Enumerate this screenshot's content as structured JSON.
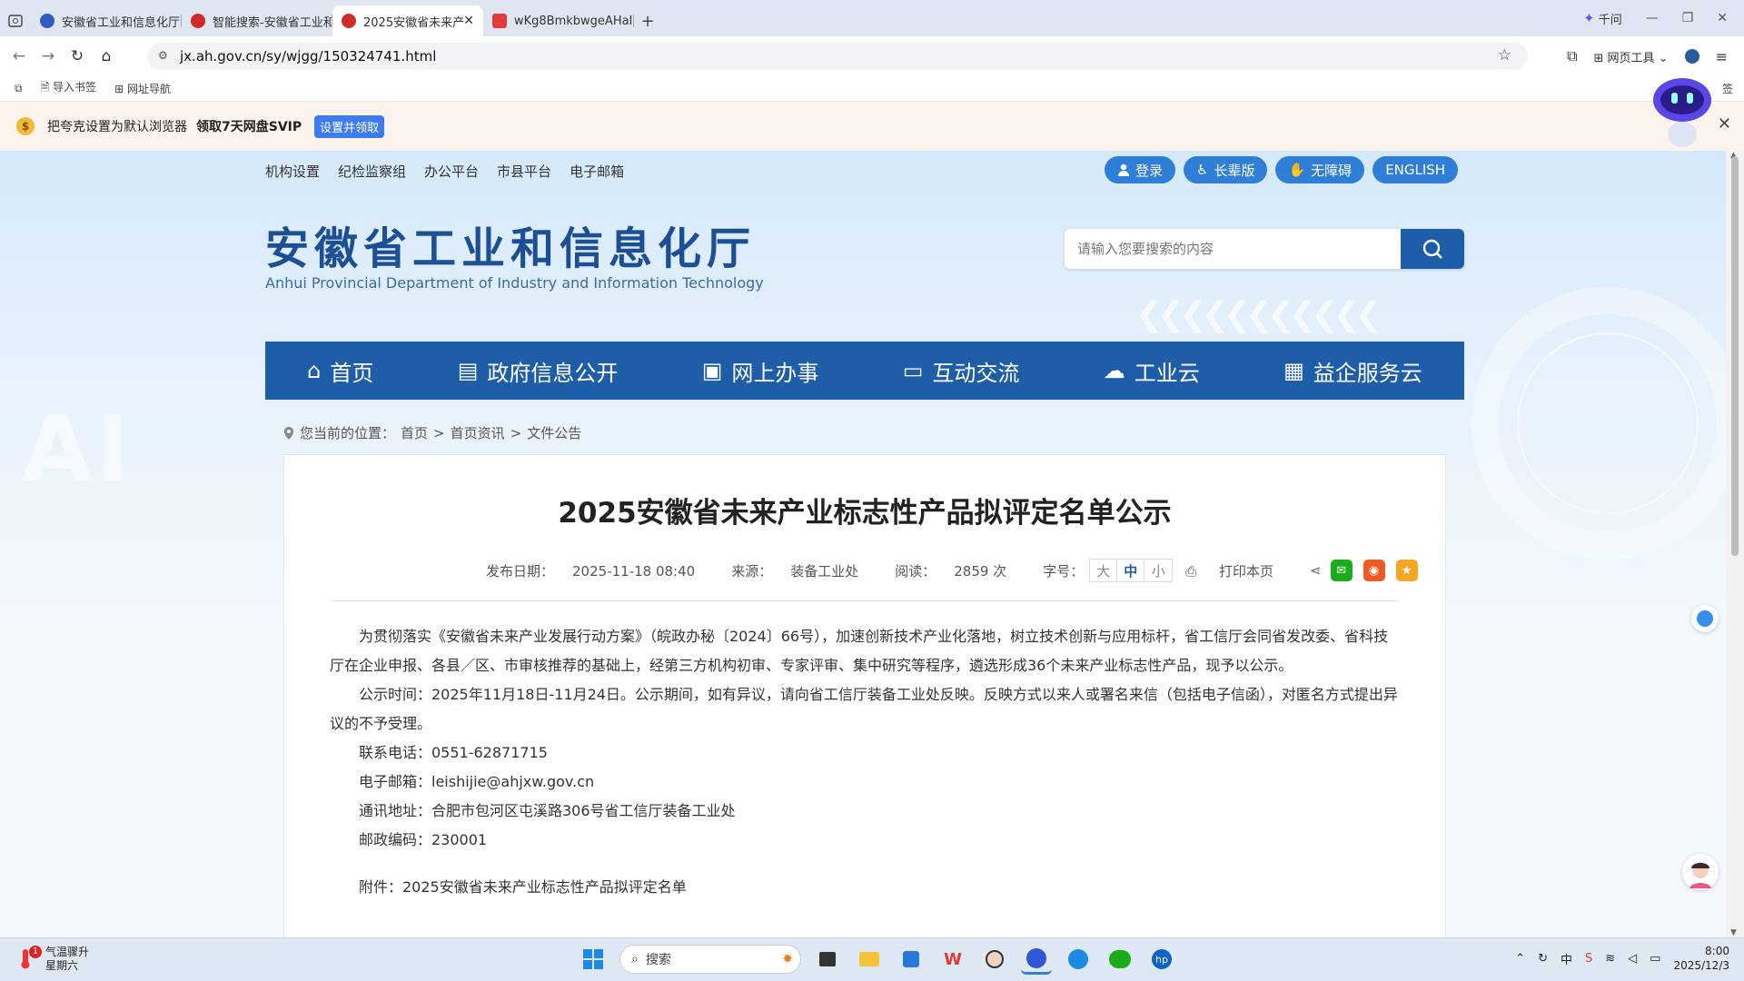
{
  "browser": {
    "tabs": [
      {
        "label": "安徽省工业和信息化厅",
        "active": false
      },
      {
        "label": "智能搜索-安徽省工业和",
        "active": false
      },
      {
        "label": "2025安徽省未来产",
        "active": true
      },
      {
        "label": "wKg8BmkbwgeAHaIl",
        "active": false
      }
    ],
    "qianwen": "千问",
    "url": "jx.ah.gov.cn/sy/wjgg/150324741.html",
    "web_tools": "网页工具",
    "bookmarks": [
      "导入书签",
      "网址导航"
    ],
    "bm_overflow": "签"
  },
  "promo": {
    "text": "把夸克设置为默认浏览器",
    "bold": "领取7天网盘SVIP",
    "button": "设置并领取",
    "coin": "$"
  },
  "site": {
    "top_links": [
      "机构设置",
      "纪检监察组",
      "办公平台",
      "市县平台",
      "电子邮箱"
    ],
    "top_buttons": [
      "登录",
      "长辈版",
      "无障碍",
      "ENGLISH"
    ],
    "title_cn": "安徽省工业和信息化厅",
    "title_en": "Anhui Provincial Department of Industry and Information Technology",
    "search_placeholder": "请输入您要搜索的内容",
    "nav": [
      "首页",
      "政府信息公开",
      "网上办事",
      "互动交流",
      "工业云",
      "益企服务云"
    ],
    "bg_text": "AI",
    "breadcrumb": {
      "label": "您当前的位置：",
      "items": [
        "首页",
        "首页资讯",
        "文件公告"
      ],
      "sep": ">"
    }
  },
  "article": {
    "title": "2025安徽省未来产业标志性产品拟评定名单公示",
    "date_label": "发布日期：",
    "date": "2025-11-18 08:40",
    "source_label": "来源：",
    "source": "装备工业处",
    "read_label": "阅读：",
    "reads": "2859 次",
    "font_label": "字号：",
    "font_sizes": [
      "大",
      "中",
      "小"
    ],
    "print": "打印本页",
    "paragraphs": [
      "为贯彻落实《安徽省未来产业发展行动方案》（皖政办秘〔2024〕66号），加速创新技术产业化落地，树立技术创新与应用标杆，省工信厅会同省发改委、省科技厅在企业申报、各县／区、市审核推荐的基础上，经第三方机构初审、专家评审、集中研究等程序，遴选形成36个未来产业标志性产品，现予以公示。",
      "公示时间：2025年11月18日-11月24日。公示期间，如有异议，请向省工信厅装备工业处反映。反映方式以来人或署名来信（包括电子信函），对匿名方式提出异议的不予受理。",
      "联系电话：0551-62871715",
      "电子邮箱：leishijie@ahjxw.gov.cn",
      "通讯地址：合肥市包河区屯溪路306号省工信厅装备工业处",
      "邮政编码：230001",
      "",
      "附件：2025安徽省未来产业标志性产品拟评定名单"
    ]
  },
  "taskbar": {
    "weather_title": "气温骤升",
    "weather_sub": "星期六",
    "weather_badge": "1",
    "search": "搜索",
    "time": "8:00",
    "date": "2025/12/3"
  },
  "colors": {
    "nav": "#1e5ea8",
    "title": "#1c4f95",
    "pill": "#2f7fd8"
  }
}
